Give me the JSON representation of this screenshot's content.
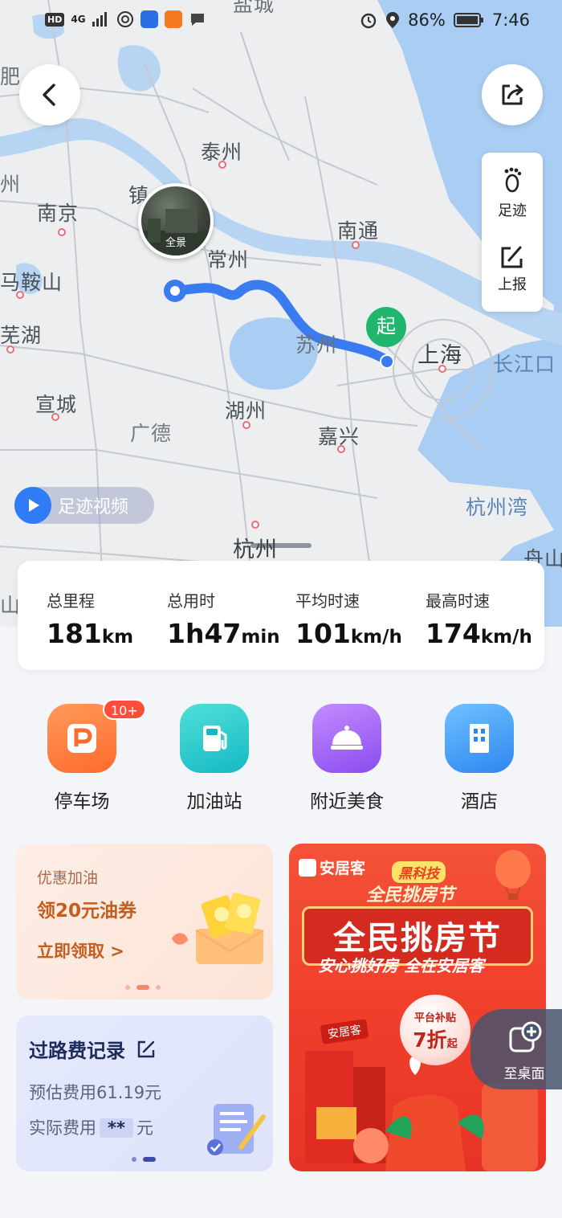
{
  "status_bar": {
    "network_left": "HD",
    "signal": "4G",
    "battery": "86%",
    "time": "7:46"
  },
  "map": {
    "cities": {
      "nanjing": "南京",
      "taizhou": "泰州",
      "zhen": "镇",
      "changzhou": "常州",
      "nantong": "南通",
      "maanshan": "马鞍山",
      "wuhu": "芜湖",
      "suzhou_partial": "苏州",
      "shanghai": "上海",
      "changjiangkou": "长江口",
      "xuancheng": "宣城",
      "huzhou": "湖州",
      "guangde": "广德",
      "jiaxing": "嘉兴",
      "hangzhouwan": "杭州湾",
      "hangzhou": "杭州",
      "zhoushan": "舟山",
      "yancheng_partial": "盐城",
      "hefei_partial": "肥",
      "zhou_partial": "州",
      "shan_partial": "山"
    },
    "panorama_label": "全景",
    "start_marker": "起",
    "video_button": "足迹视频",
    "side": {
      "footprint_label": "足迹",
      "report_label": "上报"
    },
    "route_color": "#3b7bf0"
  },
  "stats": [
    {
      "label": "总里程",
      "value": "181",
      "unit": "km"
    },
    {
      "label": "总用时",
      "value": "1h47",
      "unit": "min"
    },
    {
      "label": "平均时速",
      "value": "101",
      "unit": "km/h"
    },
    {
      "label": "最高时速",
      "value": "174",
      "unit": "km/h"
    }
  ],
  "quick": [
    {
      "label": "停车场",
      "badge": "10+"
    },
    {
      "label": "加油站"
    },
    {
      "label": "附近美食"
    },
    {
      "label": "酒店"
    }
  ],
  "fuel_card": {
    "title": "优惠加油",
    "headline": "领20元油券",
    "cta": "立即领取 >"
  },
  "toll_card": {
    "title": "过路费记录",
    "estimated": "预估费用61.19元",
    "actual_prefix": "实际费用",
    "actual_value": "**",
    "actual_suffix": "元"
  },
  "ad_card": {
    "brand": "安居客",
    "tag": "黑科技",
    "subtitle": "全民挑房节",
    "main": "全民挑房节",
    "slogan": "安心挑好房 全在安居客",
    "chip": "安居客",
    "bubble_top": "平台补贴",
    "bubble_value": "7折",
    "bubble_suffix": "起"
  },
  "float_desk": {
    "label": "至桌面"
  }
}
